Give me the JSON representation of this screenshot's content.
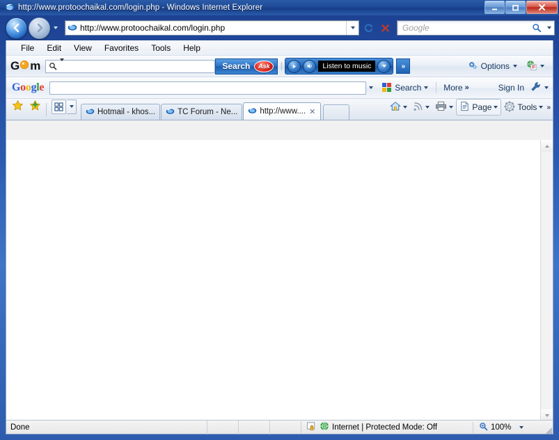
{
  "window": {
    "title": "http://www.protoochaikal.com/login.php - Windows Internet Explorer",
    "minimize_label": "–",
    "maximize_label": "❑",
    "close_label": "✕"
  },
  "address_bar": {
    "url": "http://www.protoochaikal.com/login.php",
    "back_tooltip": "Back",
    "forward_tooltip": "Forward",
    "refresh_tooltip": "Refresh",
    "stop_tooltip": "Stop",
    "search_placeholder": "Google"
  },
  "menu": {
    "items": [
      "File",
      "Edit",
      "View",
      "Favorites",
      "Tools",
      "Help"
    ]
  },
  "gom_toolbar": {
    "logo": {
      "g": "G",
      "o": "O",
      "m": "m"
    },
    "search_value": "",
    "search_button": "Search",
    "ask_logo": "Ask",
    "player_display": "Listen to music",
    "chevron": "»",
    "options_label": "Options"
  },
  "google_toolbar": {
    "logo_letters": [
      "G",
      "o",
      "o",
      "g",
      "l",
      "e"
    ],
    "search_value": "",
    "search_label": "Search",
    "more_label": "More",
    "more_chevron": "»",
    "sign_in_label": "Sign In"
  },
  "tabs": {
    "items": [
      {
        "label": "Hotmail - khos...",
        "active": false,
        "closable": false
      },
      {
        "label": "TC Forum - Ne...",
        "active": false,
        "closable": false
      },
      {
        "label": "http://www....",
        "active": true,
        "closable": true,
        "close_label": "✕"
      }
    ]
  },
  "command_bar": {
    "page_label": "Page",
    "tools_label": "Tools",
    "overflow": "»"
  },
  "status_bar": {
    "status_text": "Done",
    "security_zone": "Internet | Protected Mode: Off",
    "zoom_level": "100%"
  },
  "content": {
    "body_text": ""
  },
  "colors": {
    "titlebar_blue": "#1e4a97",
    "accent_blue": "#2a71c4",
    "ask_red": "#e5261e",
    "gom_orange": "#f5a623",
    "google_blue": "#2b5fd9",
    "google_red": "#e33f2e",
    "google_yellow": "#f2b714",
    "google_green": "#2f9e41",
    "page_background": "#ffffff"
  }
}
